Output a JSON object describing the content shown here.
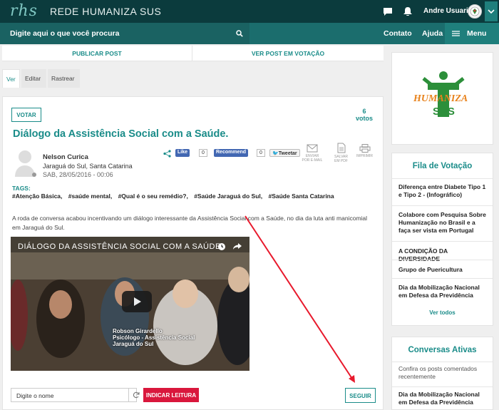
{
  "topbar": {
    "logo_short": "rhs",
    "logo_text": "REDE HUMANIZA SUS",
    "user_name": "Andre Usuario 2"
  },
  "searchbar": {
    "placeholder": "Digite aqui o que você procura",
    "nav_contato": "Contato",
    "nav_ajuda": "Ajuda",
    "nav_menu": "Menu"
  },
  "main_tabs": {
    "publicar": "PUBLICAR POST",
    "ver_votacao": "VER POST EM VOTAÇÃO"
  },
  "sub_tabs": [
    "Ver",
    "Editar",
    "Rastrear"
  ],
  "post": {
    "votar": "VOTAR",
    "votes_count": "6",
    "votes_label": "votos",
    "title": "Diálogo da Assistência Social com a Saúde.",
    "author_name": "Nelson Curica",
    "author_location": "Jaraguá do Sul, Santa Catarina",
    "date": "SAB, 28/05/2016 - 00:06",
    "like_label": "Like",
    "like_count": "0",
    "recommend_label": "Recommend",
    "recommend_count": "0",
    "tweet_label": "Tweetar",
    "action_email": "ENVIAR POR E-MAIL",
    "action_pdf": "SALVAR EM PDF",
    "action_print": "IMPRIMIR",
    "tags_label": "TAGS:",
    "tags": [
      "#Atenção Básica,",
      "#saúde mental,",
      "#Qual é o seu remédio?,",
      "#Saúde Jaraguá do Sul,",
      "#Saúde Santa Catarina"
    ],
    "body": "A roda de conversa acabou incentivando um diálogo interessante da Assistência Social com a Saúde, no dia da luta anti manicomial em Jaraguá do Sul.",
    "video_title": "DIÁLOGO DA ASSISTÊNCIA SOCIAL COM A SAÚDE",
    "video_caption_1": "Robson Girardello",
    "video_caption_2": "Psicólogo - Assistência Social",
    "video_caption_3": "Jaraguá do Sul",
    "name_placeholder": "Digite o nome",
    "indicar": "INDICAR LEITURA",
    "seguir": "SEGUIR"
  },
  "sidebar": {
    "logo_top": "HUMANIZA",
    "logo_bottom": "SUS",
    "fila_title": "Fila de Votação",
    "fila_items": [
      "Diferença entre Diabete Tipo 1 e Tipo 2 - (Infográfico)",
      "Colabore com Pesquisa Sobre Humanização no Brasil e a faça ser vista em Portugal",
      "A CONDIÇÃO DA DIVERSIDADE",
      "Grupo de Puericultura",
      "Dia da Mobilização Nacional em Defesa da Previdência"
    ],
    "ver_todos": "Ver todos",
    "conversas_title": "Conversas Ativas",
    "conversas_sub": "Confira os posts comentados recentemente",
    "conversas_items": [
      "Dia da Mobilização Nacional em Defesa da Previdência"
    ]
  },
  "colors": {
    "topbar": "#0b3b3d",
    "accent": "#1a8c89",
    "indicar": "#d9173c",
    "arrow": "#e8192c"
  }
}
